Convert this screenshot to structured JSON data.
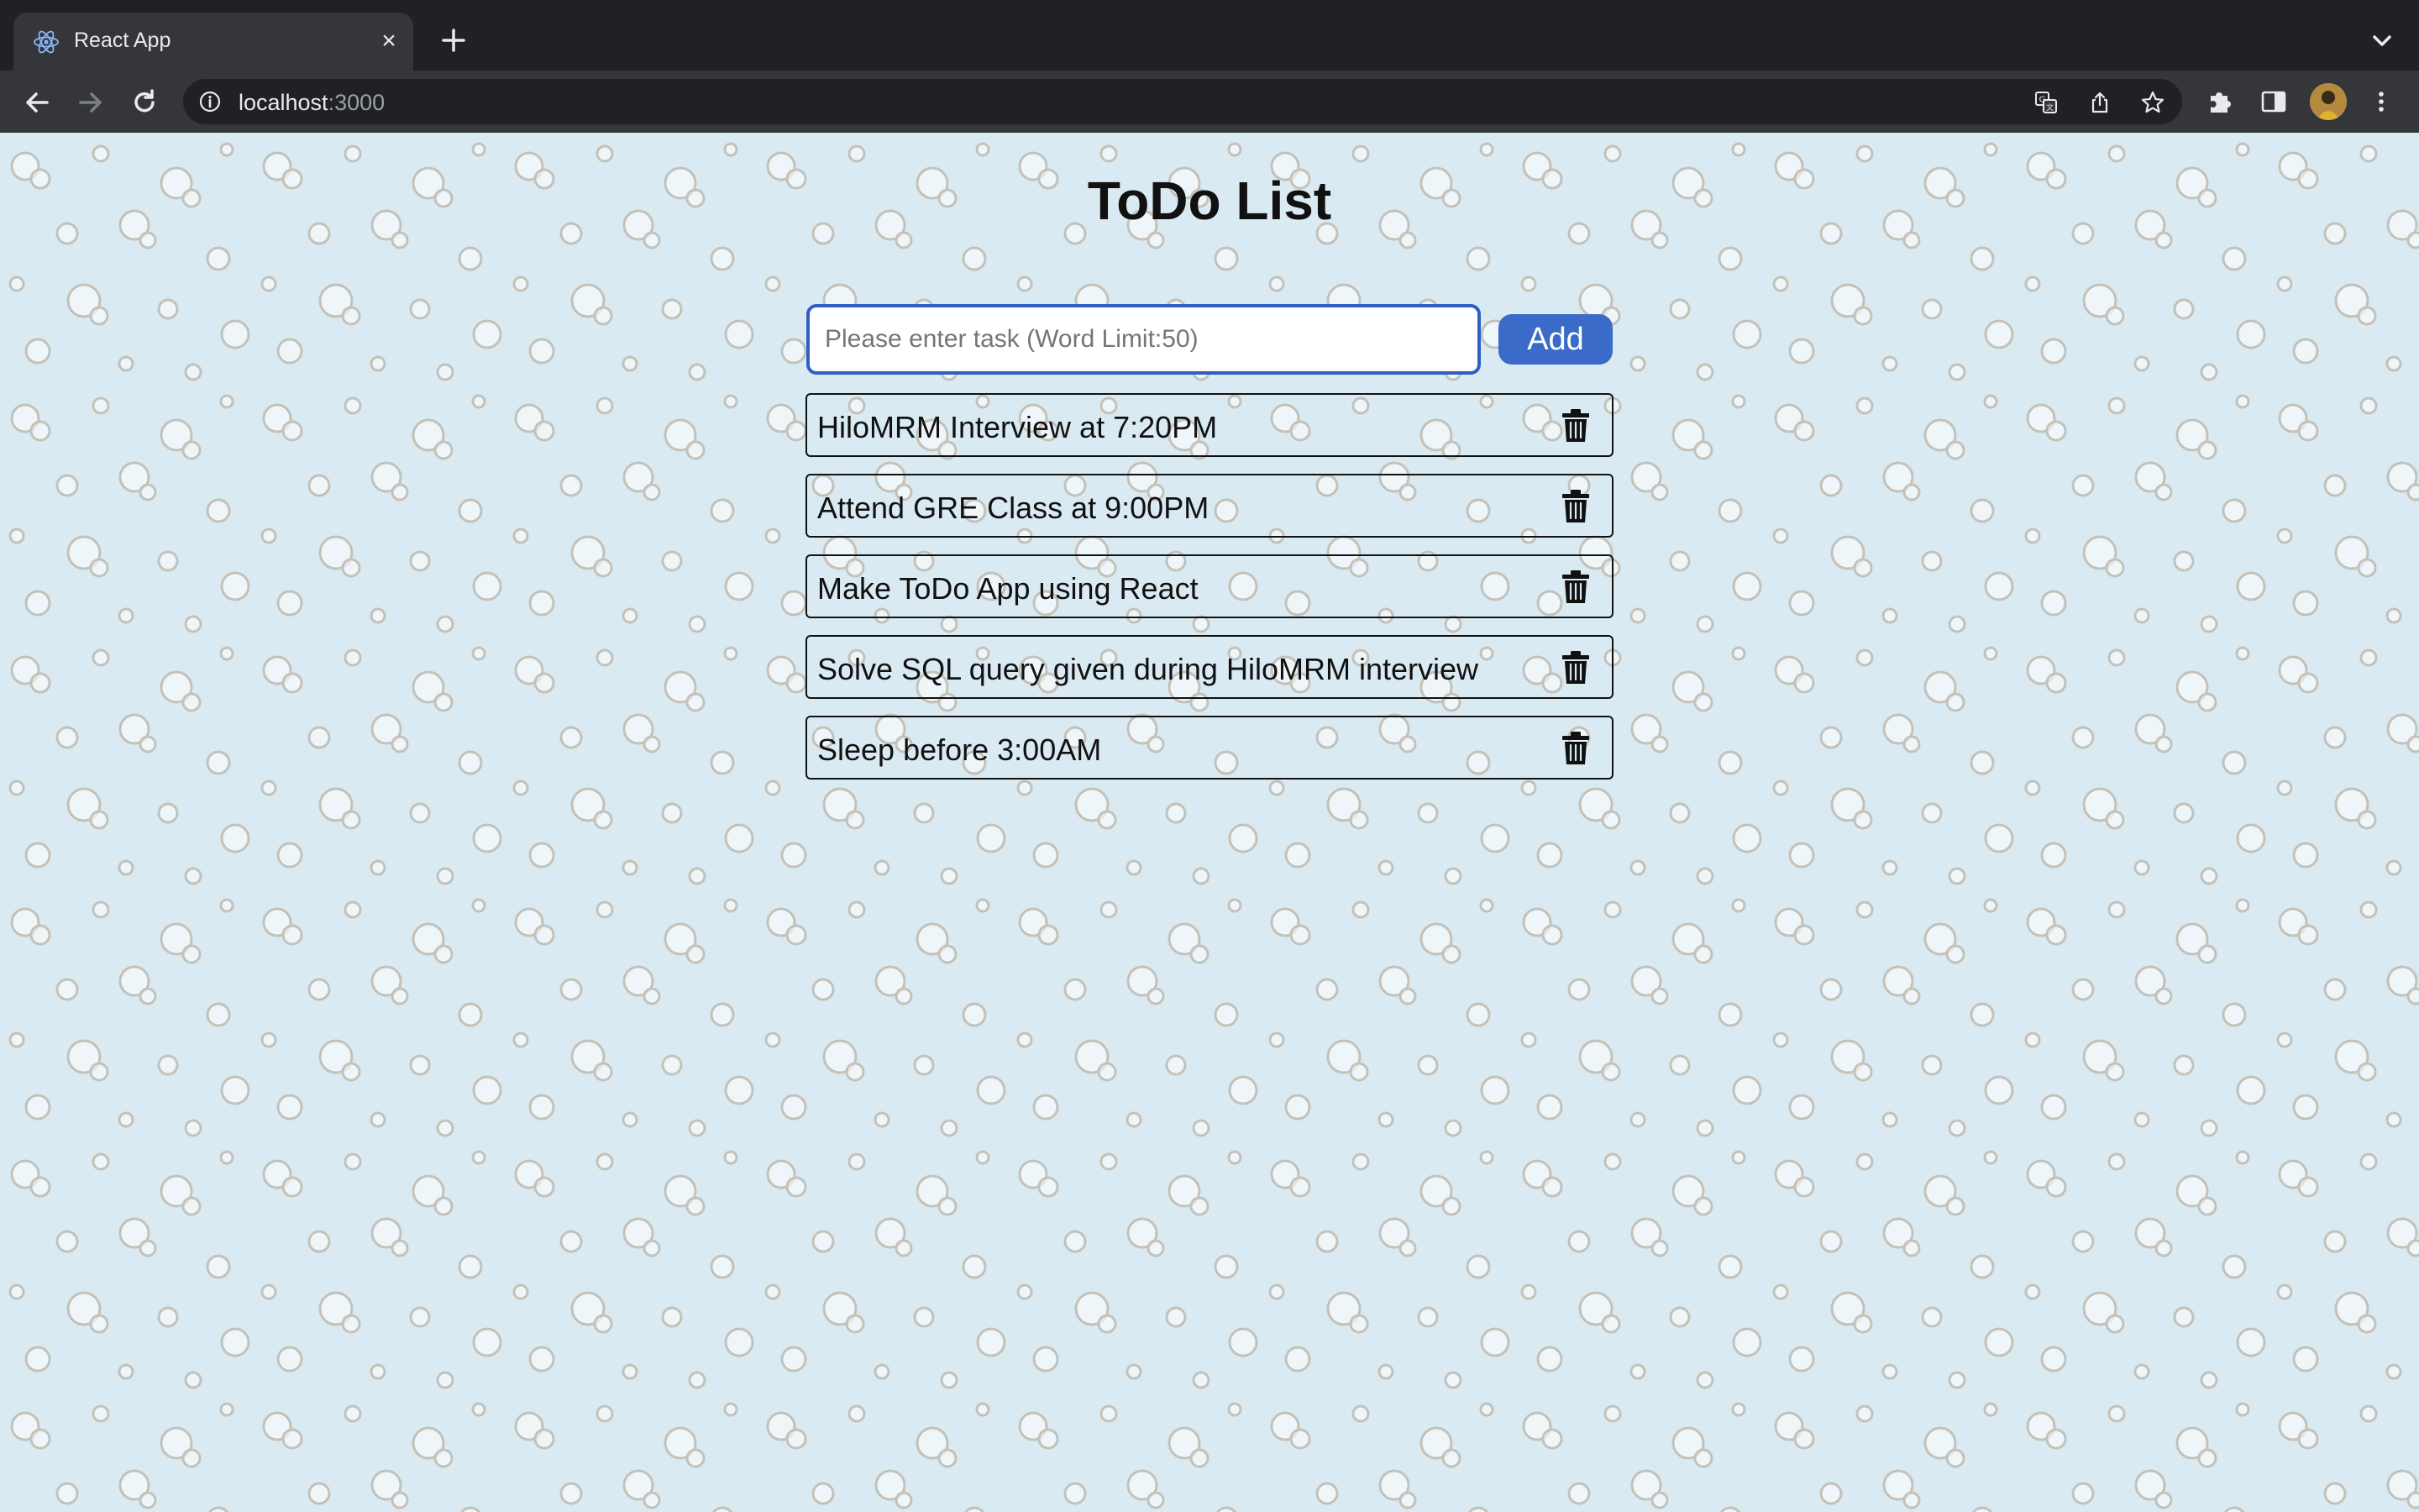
{
  "browser": {
    "tab_title": "React App",
    "tab_close": "×",
    "url_host": "localhost",
    "url_port": ":3000"
  },
  "icons": {
    "favicon": "react-atom-icon",
    "new_tab": "plus-icon",
    "tab_search": "chevron-down-icon",
    "back": "arrow-left-icon",
    "forward": "arrow-right-icon",
    "reload": "reload-icon",
    "site_info": "info-icon",
    "translate": "translate-icon",
    "share": "share-icon",
    "bookmark": "star-icon",
    "extensions": "puzzle-icon",
    "side_panel": "side-panel-icon",
    "menu": "kebab-menu-icon",
    "delete": "trash-icon"
  },
  "app": {
    "title": "ToDo List",
    "input_placeholder": "Please enter task (Word Limit:50)",
    "input_value": "",
    "add_label": "Add",
    "todos": [
      "HiloMRM Interview at 7:20PM",
      "Attend GRE Class at 9:00PM",
      "Make ToDo App using React",
      "Solve SQL query given during HiloMRM interview",
      "Sleep before 3:00AM"
    ]
  },
  "colors": {
    "page_background": "#d9eaf3",
    "accent": "#3a6bc9",
    "input_border": "#2f5fc4",
    "chrome_dark": "#202124",
    "chrome_toolbar": "#35363a"
  }
}
